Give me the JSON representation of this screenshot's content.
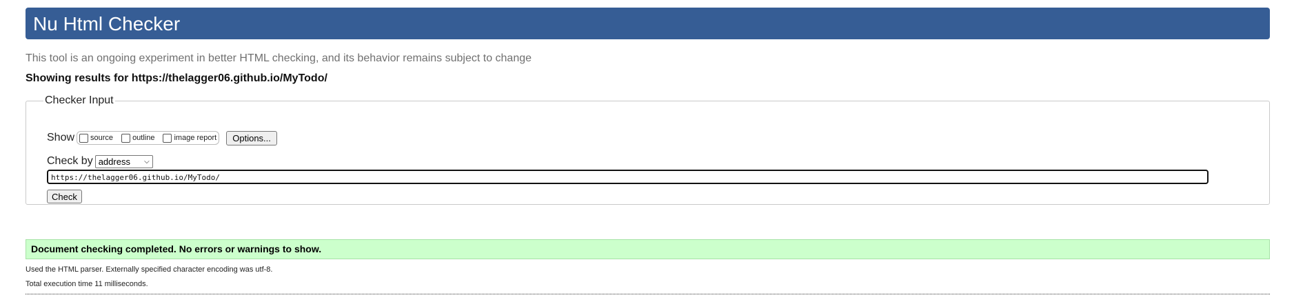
{
  "header": {
    "title": "Nu Html Checker"
  },
  "tagline": "This tool is an ongoing experiment in better HTML checking, and its behavior remains subject to change",
  "showing": "Showing results for https://thelagger06.github.io/MyTodo/",
  "checker": {
    "legend": "Checker Input",
    "show_label": "Show",
    "options": [
      {
        "label": "source",
        "checked": false
      },
      {
        "label": "outline",
        "checked": false
      },
      {
        "label": "image report",
        "checked": false
      }
    ],
    "options_button": "Options...",
    "check_by_label": "Check by",
    "check_by_value": "address",
    "url_value": "https://thelagger06.github.io/MyTodo/",
    "check_button": "Check"
  },
  "result": {
    "message": "Document checking completed. No errors or warnings to show.",
    "parser_note": "Used the HTML parser. Externally specified character encoding was utf-8.",
    "time_note": "Total execution time 11 milliseconds."
  },
  "colors": {
    "header_bg": "#365d95",
    "success_bg": "#ccffcc"
  }
}
